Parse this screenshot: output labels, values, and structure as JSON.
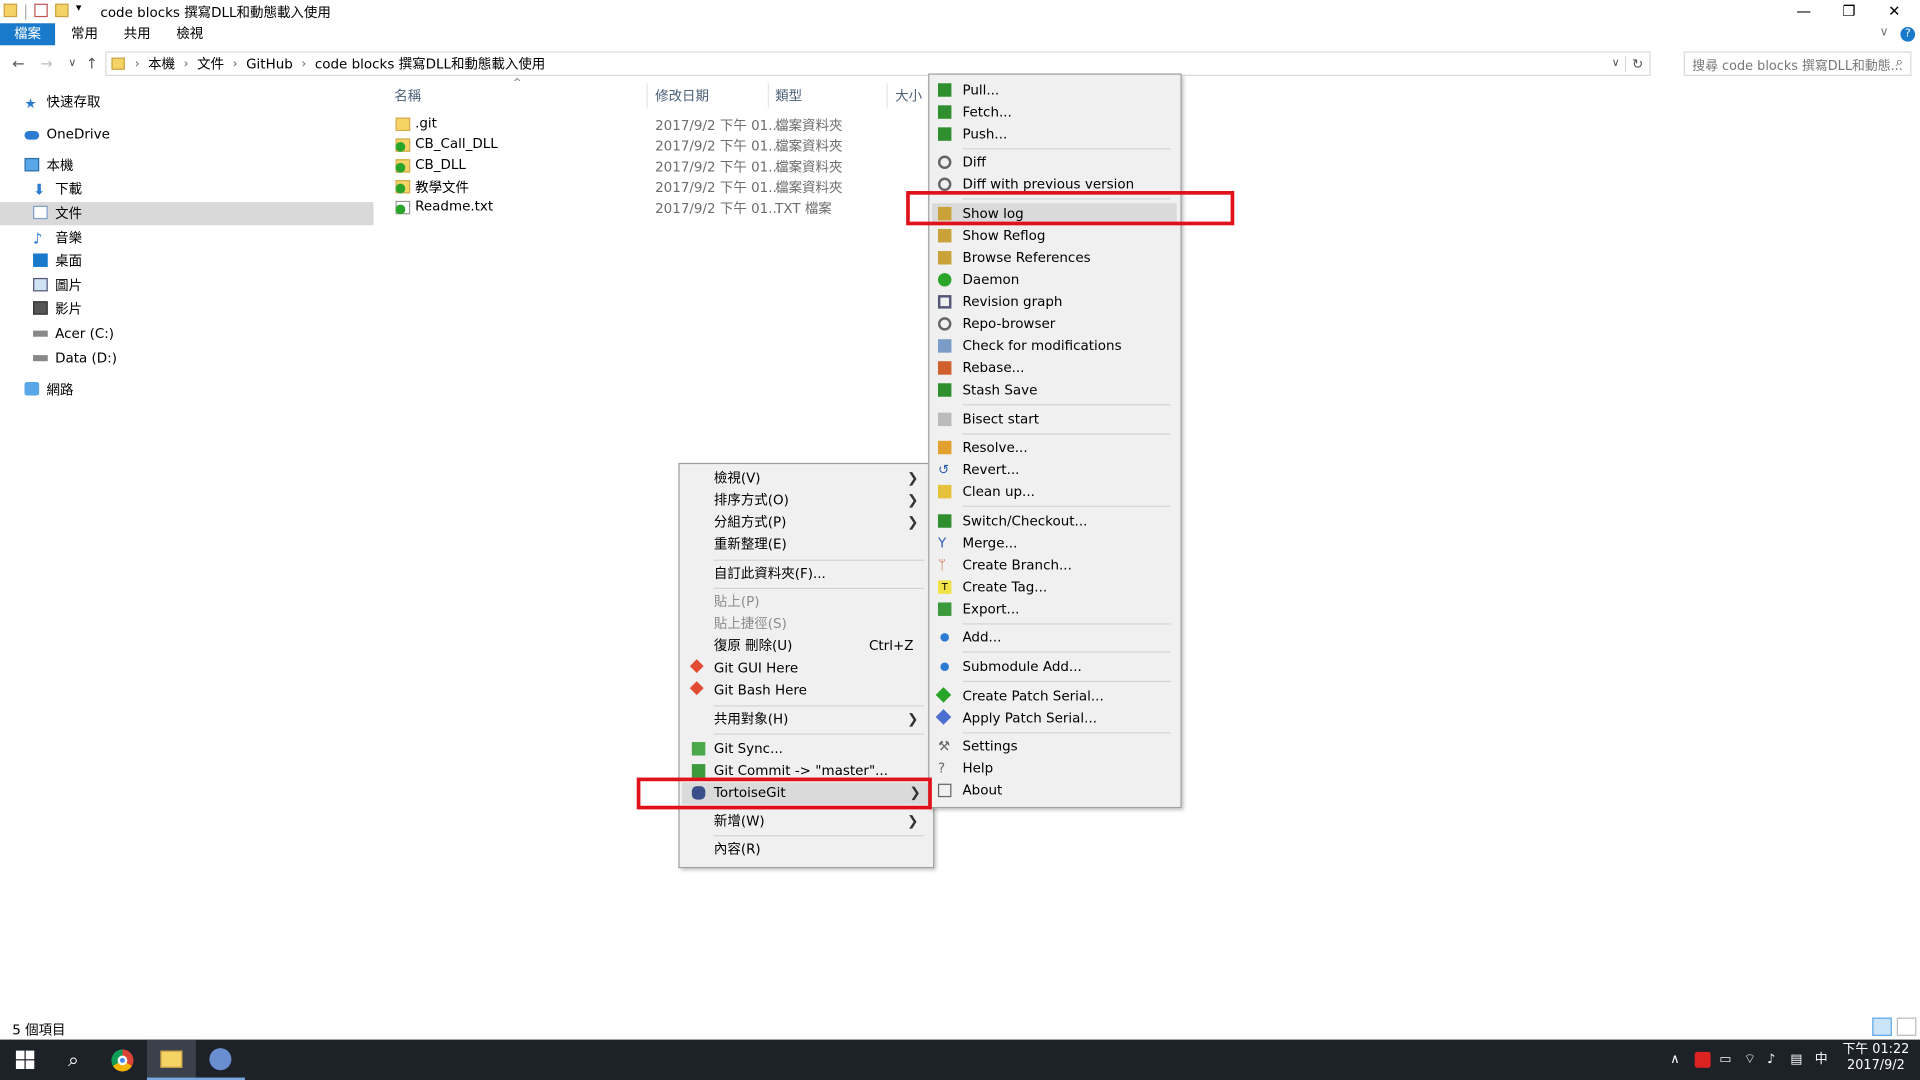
{
  "window": {
    "title": "code blocks 撰寫DLL和動態載入使用",
    "minimize_icon": "minimize-icon",
    "restore_icon": "restore-icon",
    "close_icon": "close-icon"
  },
  "ribbon": {
    "tabs": [
      {
        "label": "檔案",
        "active": true
      },
      {
        "label": "常用"
      },
      {
        "label": "共用"
      },
      {
        "label": "檢視"
      }
    ]
  },
  "address": {
    "crumbs": [
      "本機",
      "文件",
      "GitHub",
      "code blocks 撰寫DLL和動態載入使用"
    ],
    "search_placeholder": "搜尋 code blocks 撰寫DLL和動態..."
  },
  "nav": {
    "items": [
      {
        "label": "快速存取",
        "icon": "star-icon"
      },
      {
        "label": "OneDrive",
        "icon": "cloud-icon"
      },
      {
        "label": "本機",
        "icon": "computer-icon"
      },
      {
        "label": "下載",
        "icon": "download-icon"
      },
      {
        "label": "文件",
        "icon": "document-icon",
        "selected": true
      },
      {
        "label": "音樂",
        "icon": "music-icon"
      },
      {
        "label": "桌面",
        "icon": "desktop-icon"
      },
      {
        "label": "圖片",
        "icon": "pictures-icon"
      },
      {
        "label": "影片",
        "icon": "video-icon"
      },
      {
        "label": "Acer (C:)",
        "icon": "drive-icon"
      },
      {
        "label": "Data (D:)",
        "icon": "drive-icon"
      },
      {
        "label": "網路",
        "icon": "network-icon"
      }
    ]
  },
  "columns": {
    "name": "名稱",
    "date": "修改日期",
    "type": "類型",
    "size": "大小"
  },
  "files": [
    {
      "name": ".git",
      "date": "2017/9/2 下午 01...",
      "type": "檔案資料夾",
      "icon": "folder-icon"
    },
    {
      "name": "CB_Call_DLL",
      "date": "2017/9/2 下午 01...",
      "type": "檔案資料夾",
      "icon": "git-folder-icon"
    },
    {
      "name": "CB_DLL",
      "date": "2017/9/2 下午 01...",
      "type": "檔案資料夾",
      "icon": "git-folder-icon"
    },
    {
      "name": "教學文件",
      "date": "2017/9/2 下午 01...",
      "type": "檔案資料夾",
      "icon": "git-folder-icon"
    },
    {
      "name": "Readme.txt",
      "date": "2017/9/2 下午 01...",
      "type": "TXT 檔案",
      "icon": "git-file-icon"
    }
  ],
  "status": {
    "count": "5 個項目"
  },
  "context_menu": {
    "items": [
      {
        "label": "檢視(V)",
        "submenu": true
      },
      {
        "label": "排序方式(O)",
        "submenu": true
      },
      {
        "label": "分組方式(P)",
        "submenu": true
      },
      {
        "label": "重新整理(E)"
      },
      {
        "label": "自訂此資料夾(F)..."
      },
      {
        "label": "貼上(P)",
        "disabled": true
      },
      {
        "label": "貼上捷徑(S)",
        "disabled": true
      },
      {
        "label": "復原 刪除(U)",
        "shortcut": "Ctrl+Z"
      },
      {
        "label": "Git GUI Here",
        "icon": "git-gui-icon"
      },
      {
        "label": "Git Bash Here",
        "icon": "git-bash-icon"
      },
      {
        "label": "共用對象(H)",
        "submenu": true
      },
      {
        "label": "Git Sync...",
        "icon": "git-sync-icon"
      },
      {
        "label": "Git Commit -> \"master\"...",
        "icon": "git-commit-icon"
      },
      {
        "label": "TortoiseGit",
        "icon": "tortoisegit-icon",
        "submenu": true,
        "highlighted": true
      },
      {
        "label": "新增(W)",
        "submenu": true
      },
      {
        "label": "內容(R)"
      }
    ]
  },
  "tortoise_menu": {
    "items": [
      {
        "label": "Pull...",
        "icon": "pull-icon"
      },
      {
        "label": "Fetch...",
        "icon": "fetch-icon"
      },
      {
        "label": "Push...",
        "icon": "push-icon"
      },
      {
        "label": "Diff",
        "icon": "diff-icon"
      },
      {
        "label": "Diff with previous version",
        "icon": "diff-previous-icon"
      },
      {
        "label": "Show log",
        "icon": "show-log-icon",
        "highlighted": true
      },
      {
        "label": "Show Reflog",
        "icon": "reflog-icon"
      },
      {
        "label": "Browse References",
        "icon": "browse-references-icon"
      },
      {
        "label": "Daemon",
        "icon": "daemon-icon"
      },
      {
        "label": "Revision graph",
        "icon": "revision-graph-icon"
      },
      {
        "label": "Repo-browser",
        "icon": "repo-browser-icon"
      },
      {
        "label": "Check for modifications",
        "icon": "check-modifications-icon"
      },
      {
        "label": "Rebase...",
        "icon": "rebase-icon"
      },
      {
        "label": "Stash Save",
        "icon": "stash-save-icon"
      },
      {
        "label": "Bisect start",
        "icon": "bisect-icon"
      },
      {
        "label": "Resolve...",
        "icon": "resolve-icon"
      },
      {
        "label": "Revert...",
        "icon": "revert-icon"
      },
      {
        "label": "Clean up...",
        "icon": "cleanup-icon"
      },
      {
        "label": "Switch/Checkout...",
        "icon": "switch-icon"
      },
      {
        "label": "Merge...",
        "icon": "merge-icon"
      },
      {
        "label": "Create Branch...",
        "icon": "branch-icon"
      },
      {
        "label": "Create Tag...",
        "icon": "tag-icon"
      },
      {
        "label": "Export...",
        "icon": "export-icon"
      },
      {
        "label": "Add...",
        "icon": "add-icon"
      },
      {
        "label": "Submodule Add...",
        "icon": "submodule-add-icon"
      },
      {
        "label": "Create Patch Serial...",
        "icon": "create-patch-icon"
      },
      {
        "label": "Apply Patch Serial...",
        "icon": "apply-patch-icon"
      },
      {
        "label": "Settings",
        "icon": "settings-icon"
      },
      {
        "label": "Help",
        "icon": "help-icon"
      },
      {
        "label": "About",
        "icon": "about-icon"
      }
    ]
  },
  "taskbar": {
    "time": "下午 01:22",
    "date": "2017/9/2",
    "ime": "中",
    "apps": [
      "windows-start-icon",
      "search-icon",
      "chrome-icon",
      "file-explorer-icon",
      "tortoisegit-app-icon"
    ]
  },
  "colors": {
    "accent": "#1979ca",
    "highlight_border": "#e0111a",
    "menu_bg": "#f0f0f0",
    "taskbar": "#1d2128"
  }
}
